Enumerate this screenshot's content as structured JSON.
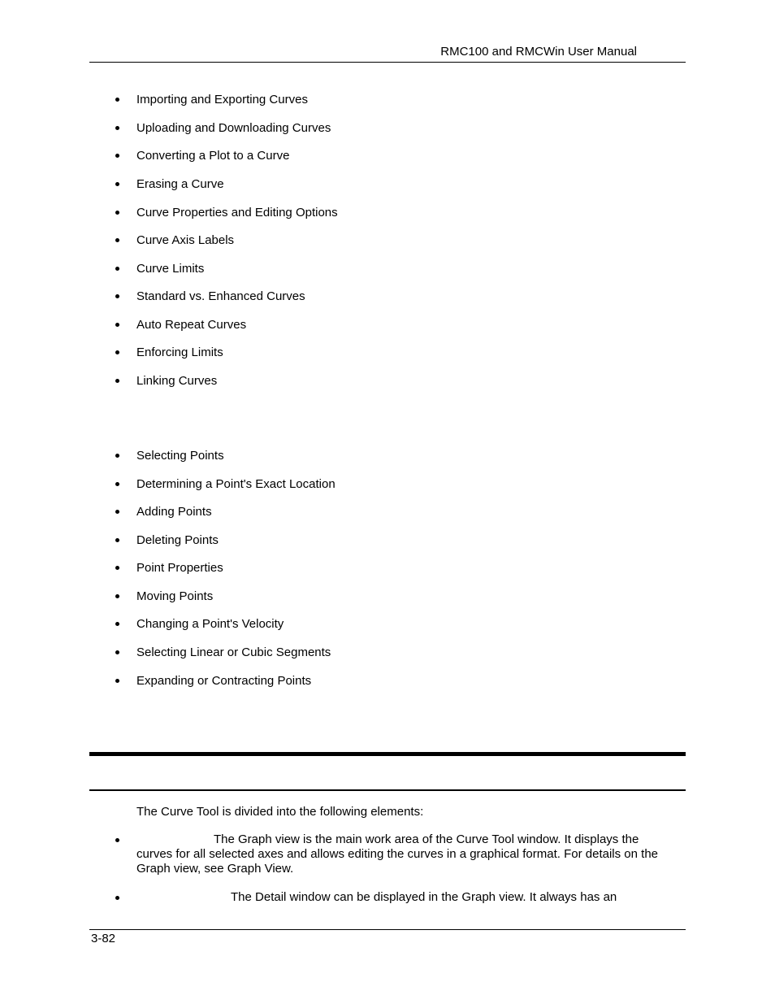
{
  "header": {
    "title": "RMC100 and RMCWin User Manual"
  },
  "list_curves": {
    "items": [
      "Importing and Exporting Curves",
      "Uploading and Downloading Curves",
      "Converting a Plot to a Curve",
      "Erasing a Curve",
      "Curve Properties and Editing Options",
      "Curve Axis Labels",
      "Curve Limits",
      "Standard vs. Enhanced Curves",
      "Auto Repeat Curves",
      "Enforcing Limits",
      "Linking Curves"
    ]
  },
  "list_points": {
    "items": [
      "Selecting Points",
      "Determining a Point's Exact Location",
      "Adding Points",
      "Deleting Points",
      "Point Properties",
      "Moving Points",
      "Changing a Point's Velocity",
      "Selecting Linear or Cubic Segments",
      "Expanding or Contracting Points"
    ]
  },
  "section": {
    "intro": "The Curve Tool is divided into the following elements:",
    "elements": [
      {
        "text_line1": "The Graph view is the main work area of the Curve Tool window. It displays the",
        "text_rest": "curves for all selected axes and allows editing the curves in a graphical format. For details on the Graph view, see Graph View."
      },
      {
        "text_line1": "The Detail window can be displayed in the Graph view. It always has an",
        "text_rest": ""
      }
    ]
  },
  "footer": {
    "page_number": "3-82"
  }
}
